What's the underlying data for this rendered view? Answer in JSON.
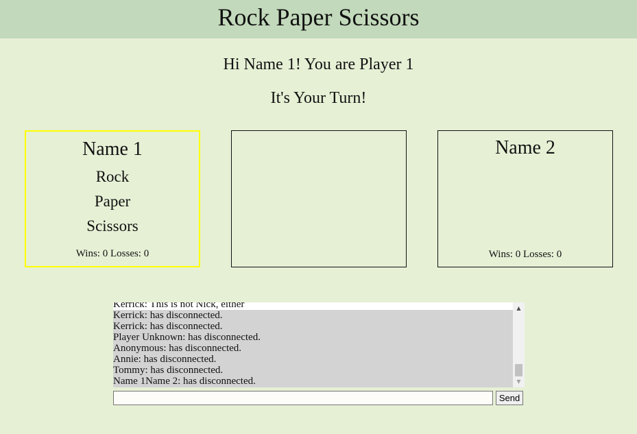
{
  "header": {
    "title": "Rock Paper Scissors"
  },
  "status": {
    "greeting": "Hi Name 1! You are Player 1",
    "turn": "It's Your Turn!"
  },
  "player1": {
    "name": "Name 1",
    "choices": [
      "Rock",
      "Paper",
      "Scissors"
    ],
    "score": "Wins: 0 Losses: 0"
  },
  "player2": {
    "name": "Name 2",
    "score": "Wins: 0 Losses: 0"
  },
  "chat": {
    "messages": [
      "Kerrick: This is not Nick, either",
      "Kerrick: has disconnected.",
      "Kerrick: has disconnected.",
      "Player Unknown: has disconnected.",
      "Anonymous: has disconnected.",
      "Annie: has disconnected.",
      "Tommy: has disconnected.",
      "Name 1Name 2: has disconnected."
    ],
    "input_value": "",
    "send_label": "Send"
  },
  "colors": {
    "background": "#e6f0d5",
    "header": "#c2d9bb",
    "active_border": "#ffff00",
    "chat_bg": "#d3d3d3"
  }
}
